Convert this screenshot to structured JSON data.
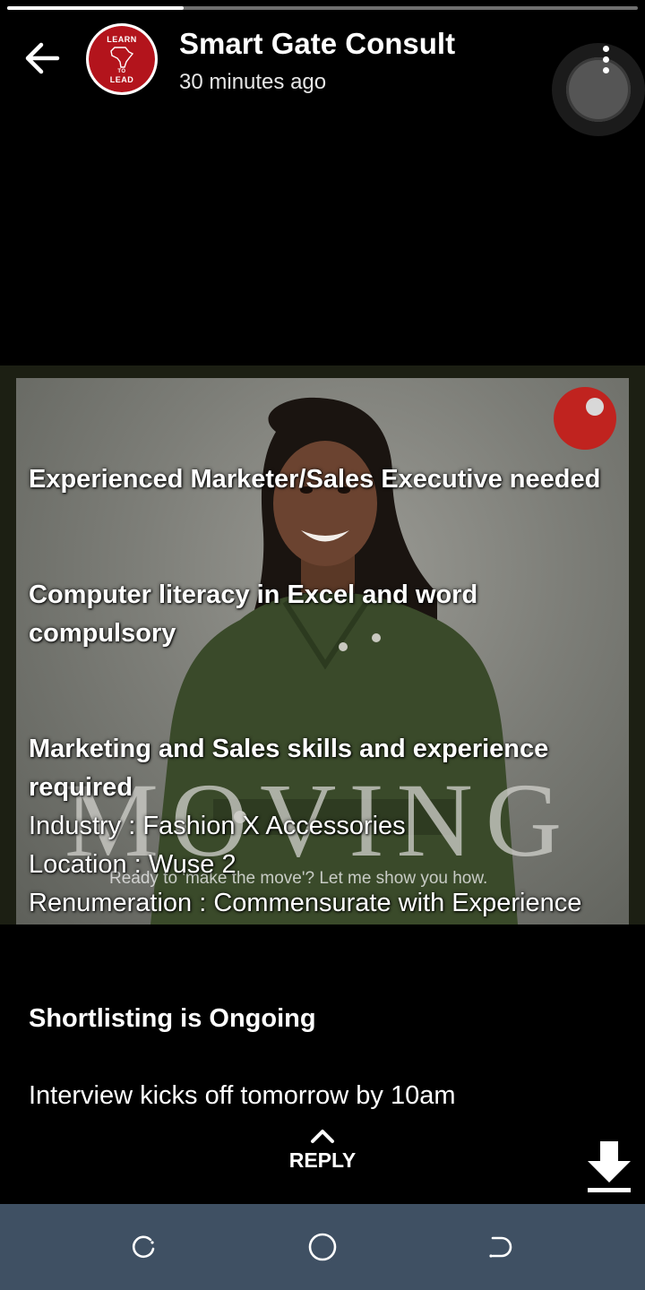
{
  "status": {
    "progress_fraction": 0.28
  },
  "header": {
    "title": "Smart Gate Consult",
    "subtitle": "30 minutes ago",
    "avatar_lines": [
      "LEARN",
      "TO",
      "LEAD"
    ]
  },
  "photo": {
    "overlay_word": "MOVING",
    "tagline": "Ready to 'make the move'? Let me show you how."
  },
  "caption": {
    "line_1": "Experienced  Marketer/Sales Executive needed",
    "line_2": "Computer literacy in Excel and word compulsory",
    "line_3": "Marketing and Sales skills and experience required",
    "line_4": "Industry : Fashion X Accessories",
    "line_5": "Location : Wuse 2",
    "line_6": "Renumeration : Commensurate with Experience",
    "line_7": "Shortlisting is Ongoing",
    "line_8": "Interview kicks off tomorrow by 10am"
  },
  "footer": {
    "reply_label": "REPLY"
  },
  "icons": {
    "back": "arrow-left-icon",
    "menu": "more-vertical-icon",
    "reply": "chevron-up-icon",
    "download": "download-icon",
    "recents": "recents-icon",
    "home": "home-icon",
    "nav_back": "back-icon"
  },
  "colors": {
    "accent_red": "#c0231f",
    "navbar": "#3f5063"
  }
}
